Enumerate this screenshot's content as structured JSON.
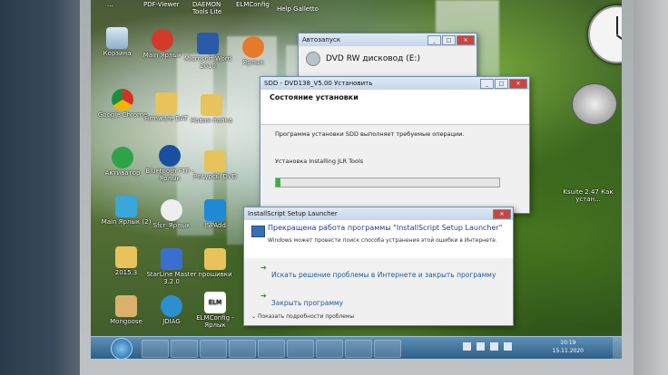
{
  "desktop": {
    "top_labels": [
      "...",
      "PDF-Viewer",
      "DAEMON Tools Lite",
      "ELMConfig",
      "Help Galletto"
    ],
    "icons": [
      {
        "label": "Корзина"
      },
      {
        "label": "Main Ярлык"
      },
      {
        "label": "Microsoft Word 2010"
      },
      {
        "label": "Ярлык"
      },
      {
        "label": "Google Chrome"
      },
      {
        "label": "Firmware DAT"
      },
      {
        "label": "Новая папка"
      },
      {
        "label": "Активатор"
      },
      {
        "label": "Bluetooth FTP - Ярлык"
      },
      {
        "label": "Ресурсы DVD"
      },
      {
        "label": "Main Ярлык (2)"
      },
      {
        "label": "Sfcr_Ярлык"
      },
      {
        "label": "ISPAdd"
      },
      {
        "label": "2015.3"
      },
      {
        "label": "StarLine Master 3.2.0"
      },
      {
        "label": "прошивки"
      },
      {
        "label": "Mongoose"
      },
      {
        "label": "JDIAG"
      },
      {
        "label": "ELMConfig - Ярлык"
      },
      {
        "label": "Ksuite 2.47 Как устан..."
      }
    ]
  },
  "autorun": {
    "title": "Автозапуск",
    "drive": "DVD RW дисковод (E:)"
  },
  "sdd": {
    "title": "SDD - DVD138_V5.00 Установить",
    "section_title": "Состояние установки",
    "status_text": "Программа установки SDD выполняет требуемые операции.",
    "task_text": "Установка Installing JLR Tools",
    "progress": 0.02
  },
  "crash": {
    "title": "InstallScript Setup Launcher",
    "heading": "Прекращена работа программы \"InstallScript Setup Launcher\"",
    "description": "Windows может провести поиск способа устранения этой ошибки в Интернете.",
    "option_search": "Искать решение проблемы в Интернете и закрыть программу",
    "option_close": "Закрыть программу",
    "details": "Показать подробности проблемы"
  },
  "taskbar": {
    "time": "10:19",
    "date": "15.11.2020"
  }
}
